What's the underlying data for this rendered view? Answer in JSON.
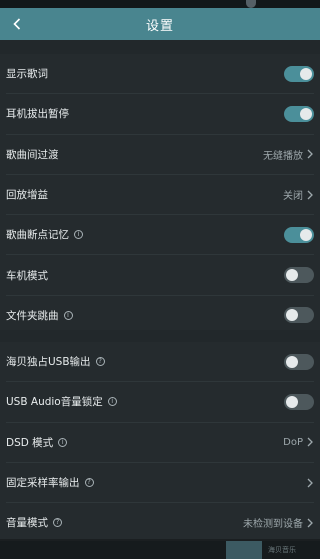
{
  "header": {
    "title": "设置"
  },
  "sections": [
    {
      "items": [
        {
          "label": "显示歌词",
          "control": "toggle",
          "on": true
        },
        {
          "label": "耳机拔出暂停",
          "control": "toggle",
          "on": true
        },
        {
          "label": "歌曲间过渡",
          "control": "value",
          "value": "无缝播放"
        },
        {
          "label": "回放增益",
          "control": "value",
          "value": "关闭"
        },
        {
          "label": "歌曲断点记忆",
          "control": "toggle",
          "on": true,
          "info": "i"
        },
        {
          "label": "车机模式",
          "control": "toggle",
          "on": false
        },
        {
          "label": "文件夹跳曲",
          "control": "toggle",
          "on": false,
          "info": "i"
        }
      ]
    },
    {
      "items": [
        {
          "label": "海贝独占USB输出",
          "control": "toggle",
          "on": false,
          "info": "?"
        },
        {
          "label": "USB Audio音量锁定",
          "control": "toggle",
          "on": false,
          "info": "i"
        },
        {
          "label": "DSD 模式",
          "control": "value",
          "value": "DoP",
          "info": "i"
        },
        {
          "label": "固定采样率输出",
          "control": "value",
          "value": "",
          "info": "?"
        },
        {
          "label": "音量模式",
          "control": "value",
          "value": "未检测到设备",
          "info": "?"
        }
      ]
    }
  ],
  "footer": {
    "app_label": "海贝音乐"
  },
  "colors": {
    "accent": "#49858f",
    "toggle_on": "#4b8f9a",
    "toggle_off": "#4d585c",
    "background": "#1b1f21"
  }
}
